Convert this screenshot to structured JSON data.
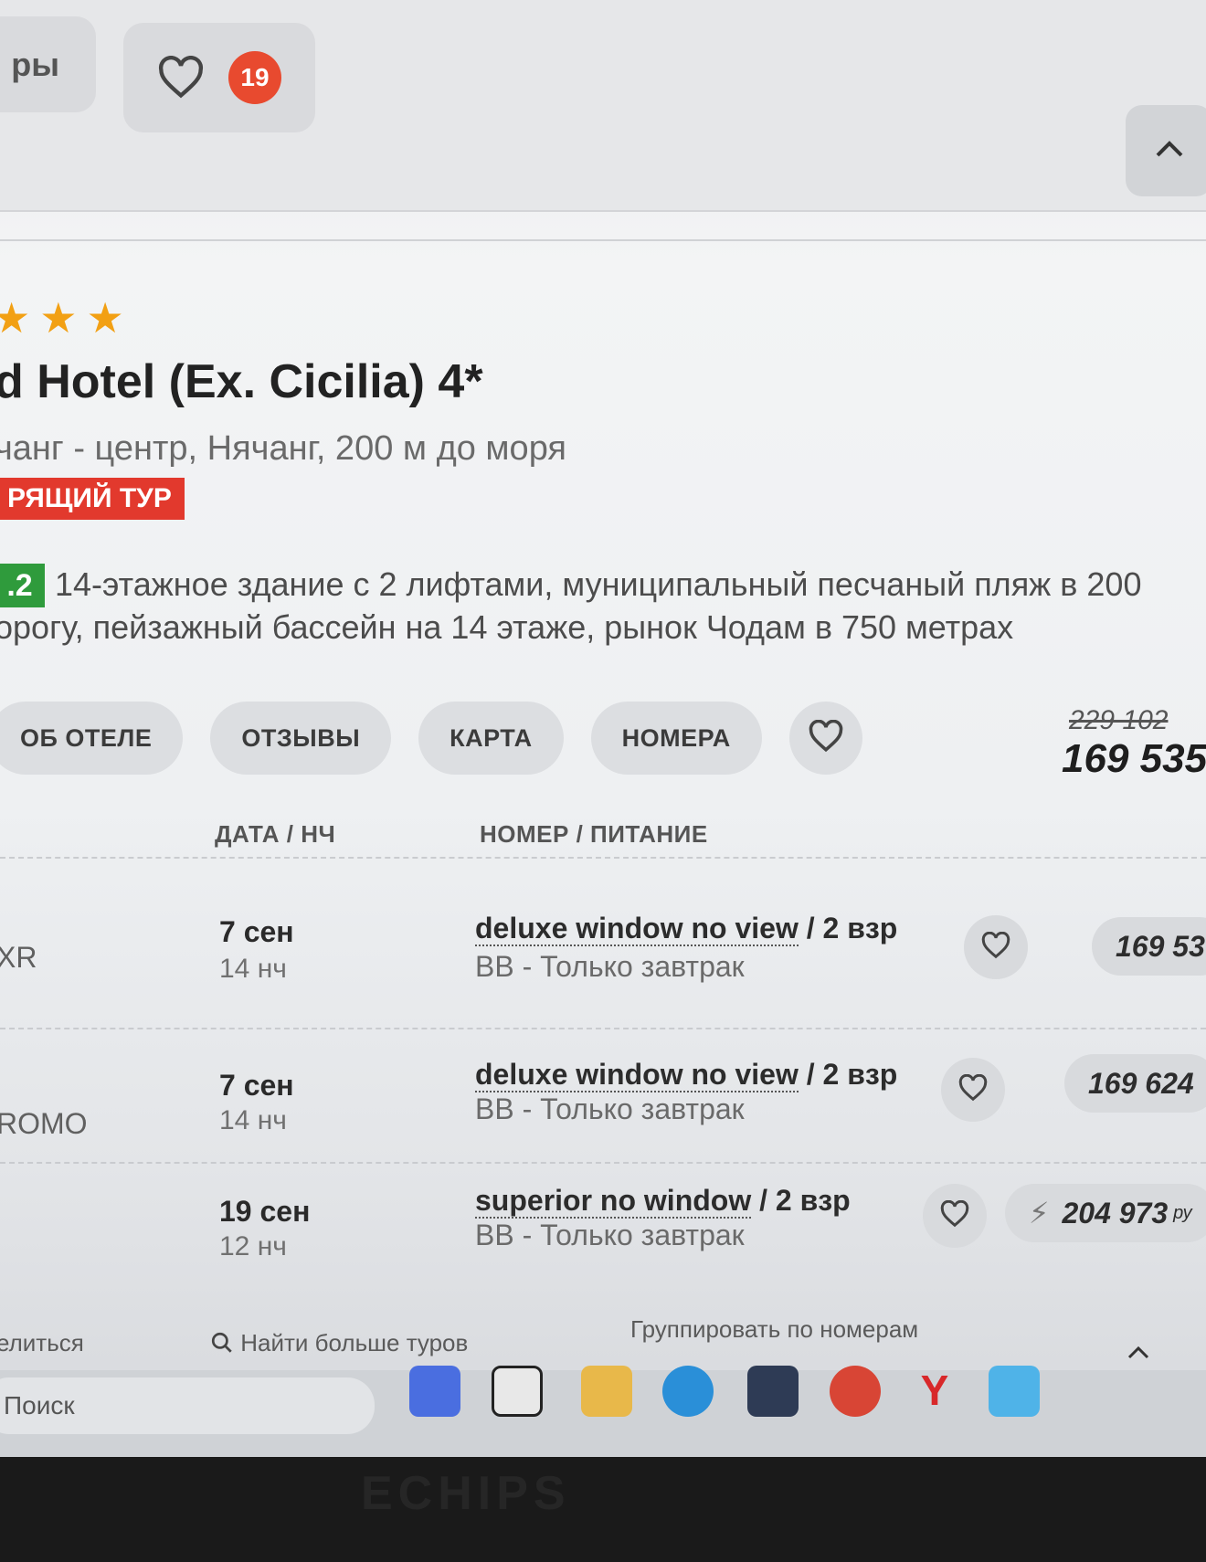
{
  "header": {
    "left_pill_text": "ры",
    "favorites_count": "19"
  },
  "hotel": {
    "stars": [
      "★",
      "★",
      "★"
    ],
    "title": "d Hotel (Ex. Cicilia) 4*",
    "location": "чанг - центр, Нячанг, 200 м до моря",
    "tag": "РЯЩИЙ ТУР",
    "rating": ".2",
    "description_line1": "14-этажное здание с 2 лифтами, муниципальный песчаный пляж в 200",
    "description_line2": "орогу, пейзажный бассейн на 14 этаже, рынок Чодам в 750 метрах"
  },
  "tabs": [
    {
      "label": "ОБ ОТЕЛЕ"
    },
    {
      "label": "ОТЗЫВЫ"
    },
    {
      "label": "КАРТА"
    },
    {
      "label": "НОМЕРА"
    }
  ],
  "price": {
    "old": "229 102",
    "new": "169 535"
  },
  "table": {
    "col_date": "ДАТА / НЧ",
    "col_room": "НОМЕР / ПИТАНИЕ",
    "rows": [
      {
        "operator": "XR",
        "date": "7 сен",
        "nights": "14 нч",
        "room": "deluxe window no view",
        "guests": "/ 2 взр",
        "meal": "BB - Только завтрак",
        "price": "169 53"
      },
      {
        "operator": "ROMO",
        "date": "7 сен",
        "nights": "14 нч",
        "room": "deluxe window no view",
        "guests": "/ 2 взр",
        "meal": "BB - Только завтрак",
        "price": "169 624"
      },
      {
        "operator": "",
        "date": "19 сен",
        "nights": "12 нч",
        "room": "superior no window",
        "guests": "/ 2 взр",
        "meal": "BB - Только завтрак",
        "price": "204 973",
        "currency": "ру"
      }
    ]
  },
  "footer": {
    "share": "елиться",
    "find_more": "Найти больше туров",
    "group": "Группировать по номерам"
  },
  "taskbar": {
    "search": "Поиск"
  },
  "bezel": {
    "brand": "ECHIPS"
  },
  "colors": {
    "accent_red": "#e2392d",
    "rating_green": "#2f9b3c",
    "star_orange": "#f2a014"
  }
}
